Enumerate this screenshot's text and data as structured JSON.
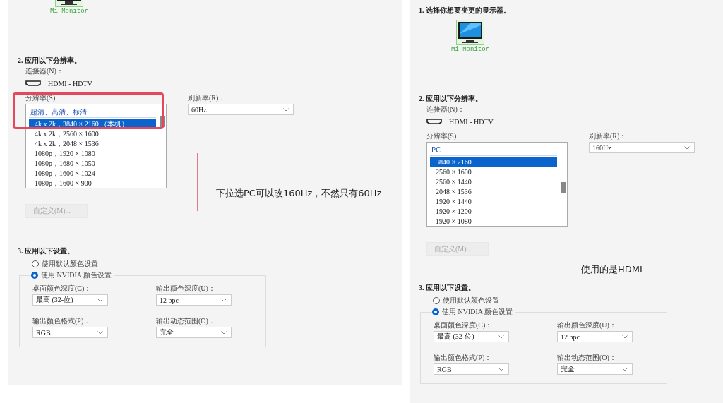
{
  "panels": [
    {
      "monitor": {
        "label": "Mi Monitor",
        "selected": true
      },
      "step2_heading": "2. 应用以下分辨率。",
      "connector_label": "连接器(N)：",
      "connector_value": "HDMI - HDTV",
      "resolution_label": "分辨率(S)",
      "resolutions": [
        {
          "kind": "group",
          "label": "超清、高清、标清"
        },
        {
          "kind": "item",
          "label": "4k x 2k，3840 × 2160 （本机）",
          "selected": true
        },
        {
          "kind": "item",
          "label": "4k x 2k，2560 × 1600",
          "selected": false
        },
        {
          "kind": "item",
          "label": "4k x 2k，2048 × 1536",
          "selected": false
        },
        {
          "kind": "item",
          "label": "1080p，1920 × 1080",
          "selected": false
        },
        {
          "kind": "item",
          "label": "1080p，1680 × 1050",
          "selected": false
        },
        {
          "kind": "item",
          "label": "1080p，1600 × 1024",
          "selected": false
        },
        {
          "kind": "item",
          "label": "1080p，1600 × 900",
          "selected": false
        }
      ],
      "highlight": true,
      "refresh_label": "刷新率(R)：",
      "refresh_value": "60Hz",
      "custom_button": {
        "label": "自定义(M)...",
        "disabled": true
      },
      "annotation": {
        "kind": "beside-list",
        "text": "下拉选PC可以改160Hz，不然只有60Hz"
      },
      "step3_heading": "3. 应用以下设置。",
      "color_modes": [
        {
          "label": "使用默认颜色设置",
          "selected": false
        },
        {
          "label": "使用 NVIDIA 颜色设置",
          "selected": true
        }
      ],
      "color_settings": [
        {
          "label": "桌面颜色深度(C)：",
          "value": "最高 (32-位)"
        },
        {
          "label": "输出颜色深度(U)：",
          "value": "12 bpc"
        },
        {
          "label": "输出颜色格式(P)：",
          "value": "RGB"
        },
        {
          "label": "输出动态范围(O)：",
          "value": "完全"
        }
      ]
    },
    {
      "step1_heading": "1. 选择你想要变更的显示器。",
      "monitor": {
        "label": "Mi Monitor",
        "selected": true
      },
      "step2_heading": "2. 应用以下分辨率。",
      "connector_label": "连接器(N)：",
      "connector_value": "HDMI - HDTV",
      "resolution_label": "分辨率(S)",
      "resolutions": [
        {
          "kind": "group",
          "label": "PC"
        },
        {
          "kind": "item",
          "label": "3840 × 2160",
          "selected": true
        },
        {
          "kind": "item",
          "label": "2560 × 1600",
          "selected": false
        },
        {
          "kind": "item",
          "label": "2560 × 1440",
          "selected": false
        },
        {
          "kind": "item",
          "label": "2048 × 1536",
          "selected": false
        },
        {
          "kind": "item",
          "label": "1920 × 1440",
          "selected": false
        },
        {
          "kind": "item",
          "label": "1920 × 1200",
          "selected": false
        },
        {
          "kind": "item",
          "label": "1920 × 1080",
          "selected": false
        }
      ],
      "highlight": false,
      "refresh_label": "刷新率(R)：",
      "refresh_value": "160Hz",
      "custom_button": {
        "label": "自定义(M)...",
        "disabled": true
      },
      "annotation": {
        "kind": "below-button",
        "text": "使用的是HDMI"
      },
      "step3_heading": "3. 应用以下设置。",
      "color_modes": [
        {
          "label": "使用默认颜色设置",
          "selected": false
        },
        {
          "label": "使用 NVIDIA 颜色设置",
          "selected": true
        }
      ],
      "color_settings": [
        {
          "label": "桌面颜色深度(C)：",
          "value": "最高 (32-位)"
        },
        {
          "label": "输出颜色深度(U)：",
          "value": "12 bpc"
        },
        {
          "label": "输出颜色格式(P)：",
          "value": "RGB"
        },
        {
          "label": "输出动态范围(O)：",
          "value": "完全"
        }
      ]
    }
  ]
}
